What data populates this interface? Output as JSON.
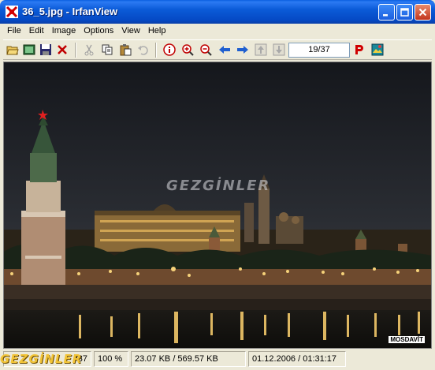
{
  "window": {
    "title": "36_5.jpg - IrfanView",
    "controls": {
      "minimize": "minimize-icon",
      "maximize": "maximize-icon",
      "close": "close-icon"
    }
  },
  "menu": [
    "File",
    "Edit",
    "Image",
    "Options",
    "View",
    "Help"
  ],
  "toolbar": {
    "page_counter": "19/37",
    "tools": [
      "open-folder-icon",
      "slideshow-icon",
      "save-icon",
      "delete-icon",
      "cut-icon",
      "copy-icon",
      "paste-icon",
      "undo-icon",
      "info-icon",
      "zoom-in-icon",
      "zoom-out-icon",
      "previous-icon",
      "next-icon",
      "first-image-icon",
      "last-image-icon",
      "paint-p-icon",
      "irfanview-logo-icon"
    ]
  },
  "image": {
    "watermark": "GEZGİNLER",
    "corner_tag": "MOSDAVİT"
  },
  "status": {
    "index": "/37",
    "zoom": "100 %",
    "size": "23.07 KB / 569.57 KB",
    "datetime": "01.12.2006 / 01:31:17"
  },
  "overlay_logo": "GEZGİNLER",
  "colors": {
    "title_bar": "#0b5bd8",
    "chrome": "#ece9d8",
    "close_button": "#c3361d"
  }
}
